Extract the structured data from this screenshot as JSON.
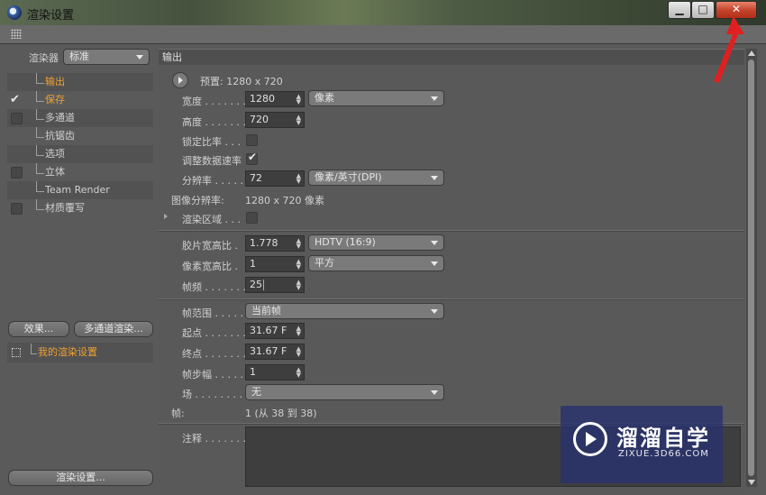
{
  "window": {
    "title": "渲染设置",
    "minimize_icon": "minimize-icon",
    "maximize_icon": "maximize-icon",
    "close_icon": "close-icon"
  },
  "left": {
    "renderer_label": "渲染器",
    "renderer_value": "标准",
    "tree": [
      {
        "label": "输出",
        "checkbox": false,
        "checked": false,
        "active": true
      },
      {
        "label": "保存",
        "checkbox": false,
        "checked": true,
        "active": false
      },
      {
        "label": "多通道",
        "checkbox": true,
        "checked": false,
        "active": false
      },
      {
        "label": "抗锯齿",
        "checkbox": false,
        "checked": false,
        "active": false
      },
      {
        "label": "选项",
        "checkbox": false,
        "checked": false,
        "active": false
      },
      {
        "label": "立体",
        "checkbox": true,
        "checked": false,
        "active": false
      },
      {
        "label": "Team Render",
        "checkbox": false,
        "checked": false,
        "active": false
      },
      {
        "label": "材质覆写",
        "checkbox": true,
        "checked": false,
        "active": false
      }
    ],
    "effects_button": "效果...",
    "multipass_button": "多通道渲染...",
    "preset_name": "我的渲染设置",
    "render_settings_button": "渲染设置..."
  },
  "output": {
    "header": "输出",
    "preset": "预置: 1280 x 720",
    "width_label": "宽度 . . . . . . .",
    "width_value": "1280",
    "width_unit": "像素",
    "height_label": "高度 . . . . . . .",
    "height_value": "720",
    "lock_ratio_label": "锁定比率 . . .",
    "adjust_rate_label": "调整数据速率",
    "resolution_label": "分辨率 . . . . .",
    "resolution_value": "72",
    "resolution_unit": "像素/英寸(DPI)",
    "image_resolution_label": "图像分辨率:",
    "image_resolution_value": "1280 x 720 像素",
    "render_region_label": "渲染区域 . . .",
    "film_aspect_label": "胶片宽高比 .",
    "film_aspect_value": "1.778",
    "film_aspect_preset": "HDTV (16:9)",
    "pixel_aspect_label": "像素宽高比 .",
    "pixel_aspect_value": "1",
    "pixel_aspect_preset": "平方",
    "fps_label": "帧频 . . . . . . .",
    "fps_value": "25",
    "frame_range_label": "帧范围 . . . . .",
    "frame_range_value": "当前帧",
    "start_label": "起点 . . . . . . .",
    "start_value": "31.67 F",
    "end_label": "终点 . . . . . . .",
    "end_value": "31.67 F",
    "frame_step_label": "帧步幅 . . . . .",
    "frame_step_value": "1",
    "field_label": "场 . . . . . . . . .",
    "field_value": "无",
    "frames_label": "帧:",
    "frames_value": "1 (从 38 到 38)",
    "notes_label": "注释 . . . . . . ."
  },
  "watermark": {
    "title": "溜溜自学",
    "subtitle": "ZIXUE.3D66.COM"
  },
  "colors": {
    "active_label": "#f0a030",
    "close_button": "#c3412a",
    "annotation_arrow": "#e02020",
    "watermark_bg": "#28326e"
  }
}
